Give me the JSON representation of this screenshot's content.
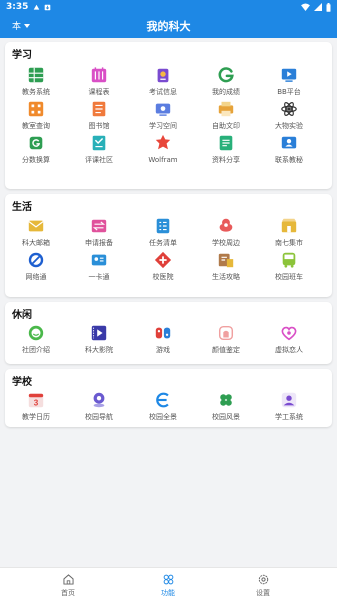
{
  "status": {
    "time": "3:35"
  },
  "header": {
    "campus": "本",
    "title": "我的科大"
  },
  "sections": [
    {
      "title": "学习",
      "items": [
        {
          "label": "教务系统",
          "icon": "grid-icon",
          "color": "#2e9e52"
        },
        {
          "label": "课程表",
          "icon": "calendar-icon",
          "color": "#d94fc6"
        },
        {
          "label": "考试信息",
          "icon": "exam-icon",
          "color": "#7a4bd0"
        },
        {
          "label": "我的成绩",
          "icon": "grade-icon",
          "color": "#2e9e52"
        },
        {
          "label": "BB平台",
          "icon": "board-icon",
          "color": "#2a7fd8"
        },
        {
          "label": "教室查询",
          "icon": "classroom-icon",
          "color": "#f08a2c"
        },
        {
          "label": "图书馆",
          "icon": "library-icon",
          "color": "#f07a3c"
        },
        {
          "label": "学习空间",
          "icon": "study-space-icon",
          "color": "#5b7de0"
        },
        {
          "label": "自助文印",
          "icon": "print-icon",
          "color": "#e6a33a"
        },
        {
          "label": "大物实验",
          "icon": "atom-icon",
          "color": "#333333"
        },
        {
          "label": "分数换算",
          "icon": "score-convert-icon",
          "color": "#2e9e52"
        },
        {
          "label": "评课社区",
          "icon": "review-icon",
          "color": "#28b0b8"
        },
        {
          "label": "Wolfram",
          "icon": "wolfram-icon",
          "color": "#e8463a"
        },
        {
          "label": "资料分享",
          "icon": "share-icon",
          "color": "#28b07a"
        },
        {
          "label": "联系教秘",
          "icon": "contact-icon",
          "color": "#2a7fd8"
        }
      ]
    },
    {
      "title": "生活",
      "items": [
        {
          "label": "科大邮箱",
          "icon": "mail-icon",
          "color": "#e6b83a"
        },
        {
          "label": "申请报备",
          "icon": "apply-icon",
          "color": "#e0529c"
        },
        {
          "label": "任务清单",
          "icon": "task-list-icon",
          "color": "#2a8fd8"
        },
        {
          "label": "学校周边",
          "icon": "nearby-icon",
          "color": "#e85a5a"
        },
        {
          "label": "南七集市",
          "icon": "market-icon",
          "color": "#e6b83a"
        },
        {
          "label": "网络通",
          "icon": "network-icon",
          "color": "#1e5fd0"
        },
        {
          "label": "一卡通",
          "icon": "card-icon",
          "color": "#2a8fd8"
        },
        {
          "label": "校医院",
          "icon": "hospital-icon",
          "color": "#e0403a"
        },
        {
          "label": "生活攻略",
          "icon": "guide-icon",
          "color": "#b07a4a"
        },
        {
          "label": "校园班车",
          "icon": "bus-icon",
          "color": "#8cc43a"
        }
      ]
    },
    {
      "title": "休闲",
      "items": [
        {
          "label": "社团介绍",
          "icon": "club-icon",
          "color": "#4ab84a"
        },
        {
          "label": "科大影院",
          "icon": "cinema-icon",
          "color": "#3a3aa8"
        },
        {
          "label": "游戏",
          "icon": "game-icon",
          "color": "#e0403a"
        },
        {
          "label": "颜值鉴定",
          "icon": "face-icon",
          "color": "#f0a0a0"
        },
        {
          "label": "虚拟恋人",
          "icon": "heart-icon",
          "color": "#d94fc6"
        }
      ]
    },
    {
      "title": "学校",
      "items": [
        {
          "label": "教学日历",
          "icon": "calendar-day-icon",
          "color": "#e0403a"
        },
        {
          "label": "校园导航",
          "icon": "navigation-icon",
          "color": "#6a5ad0"
        },
        {
          "label": "校园全景",
          "icon": "panorama-icon",
          "color": "#1e88e5"
        },
        {
          "label": "校园风景",
          "icon": "clover-icon",
          "color": "#2e9e52"
        },
        {
          "label": "学工系统",
          "icon": "student-affairs-icon",
          "color": "#7a4bd0"
        }
      ]
    }
  ],
  "calendar_day": "3",
  "bottom_nav": [
    {
      "label": "首页",
      "icon": "home-icon",
      "active": false
    },
    {
      "label": "功能",
      "icon": "features-icon",
      "active": true
    },
    {
      "label": "设置",
      "icon": "settings-icon",
      "active": false
    }
  ],
  "colors": {
    "primary": "#1e88e5",
    "background": "#f2f3f5",
    "nav_inactive": "#666666"
  }
}
